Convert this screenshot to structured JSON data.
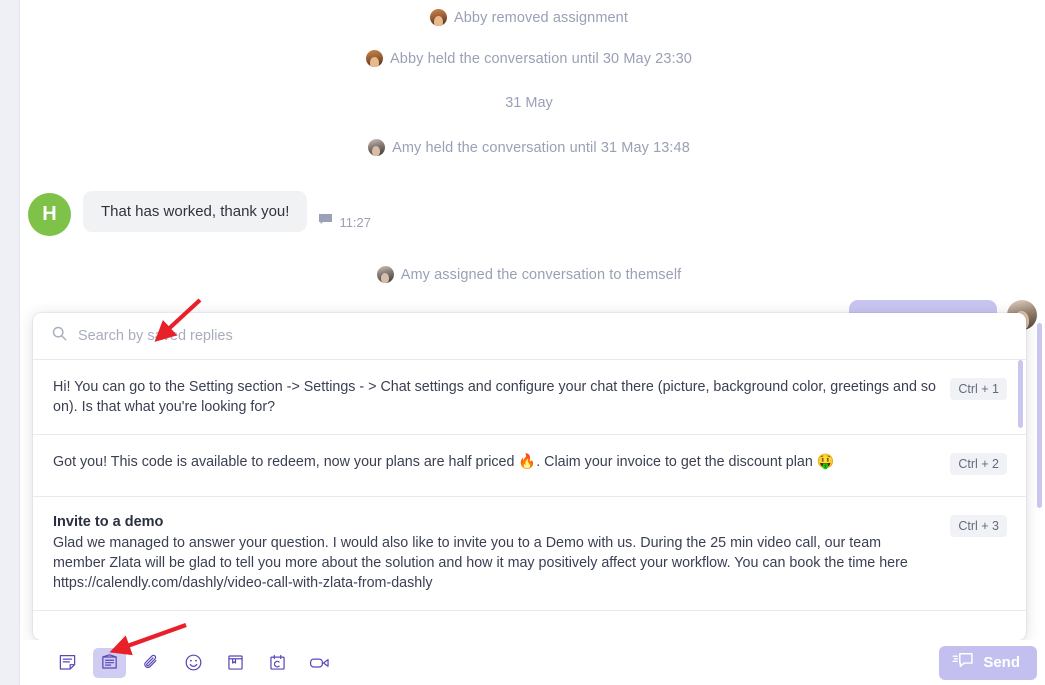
{
  "conversation": {
    "events": [
      {
        "type": "system",
        "avatar": "abby",
        "text": "Abby removed assignment"
      },
      {
        "type": "system",
        "avatar": "abby",
        "text": "Abby held the conversation until 30 May 23:30"
      },
      {
        "type": "date",
        "text": "31 May"
      },
      {
        "type": "system",
        "avatar": "amy",
        "text": "Amy held the conversation until 31 May 13:48"
      }
    ],
    "incoming_message": {
      "avatar_initial": "H",
      "avatar_color": "#7ec24a",
      "text": "That has worked, thank you!",
      "time": "11:27"
    },
    "assignment_event": {
      "avatar": "amy",
      "text": "Amy assigned the conversation to themself"
    }
  },
  "saved_replies": {
    "search": {
      "placeholder": "Search by saved replies",
      "value": "",
      "icon": "search-icon"
    },
    "items": [
      {
        "title": "",
        "text": "Hi! You can go to the Setting section -> Settings - > Chat settings and configure your chat there (picture, background color, greetings and so on). Is that what you're looking for?",
        "shortcut": "Ctrl + 1"
      },
      {
        "title": "",
        "text": "Got you! This code is available to redeem, now your plans are half priced 🔥. Claim your invoice to get the discount plan 🤑",
        "shortcut": "Ctrl + 2"
      },
      {
        "title": "Invite to a demo",
        "text": "Glad we managed to answer your question. I would also like to invite you to a Demo with us. During the 25 min video call, our team member Zlata will be glad to tell you more about the solution and how it may positively affect your workflow.  You can book the time here https://calendly.com/dashly/video-call-with-zlata-from-dashly",
        "shortcut": "Ctrl + 3"
      }
    ]
  },
  "toolbar": {
    "buttons": [
      {
        "name": "note-icon",
        "label": "Note",
        "active": false
      },
      {
        "name": "saved-replies-icon",
        "label": "Saved replies",
        "active": true
      },
      {
        "name": "attachment-icon",
        "label": "Attach file",
        "active": false
      },
      {
        "name": "emoji-icon",
        "label": "Emoji",
        "active": false
      },
      {
        "name": "knowledge-base-icon",
        "label": "Knowledge base",
        "active": false
      },
      {
        "name": "calendar-icon",
        "label": "Calendar",
        "active": false
      },
      {
        "name": "video-call-icon",
        "label": "Video call",
        "active": false
      }
    ],
    "send_label": "Send",
    "send_color": "#c3c0ef"
  },
  "annotations": {
    "arrow_color": "#e8202a",
    "arrow_1_target": "search-by-saved-replies-input",
    "arrow_2_target": "saved-replies-toolbar-button"
  }
}
